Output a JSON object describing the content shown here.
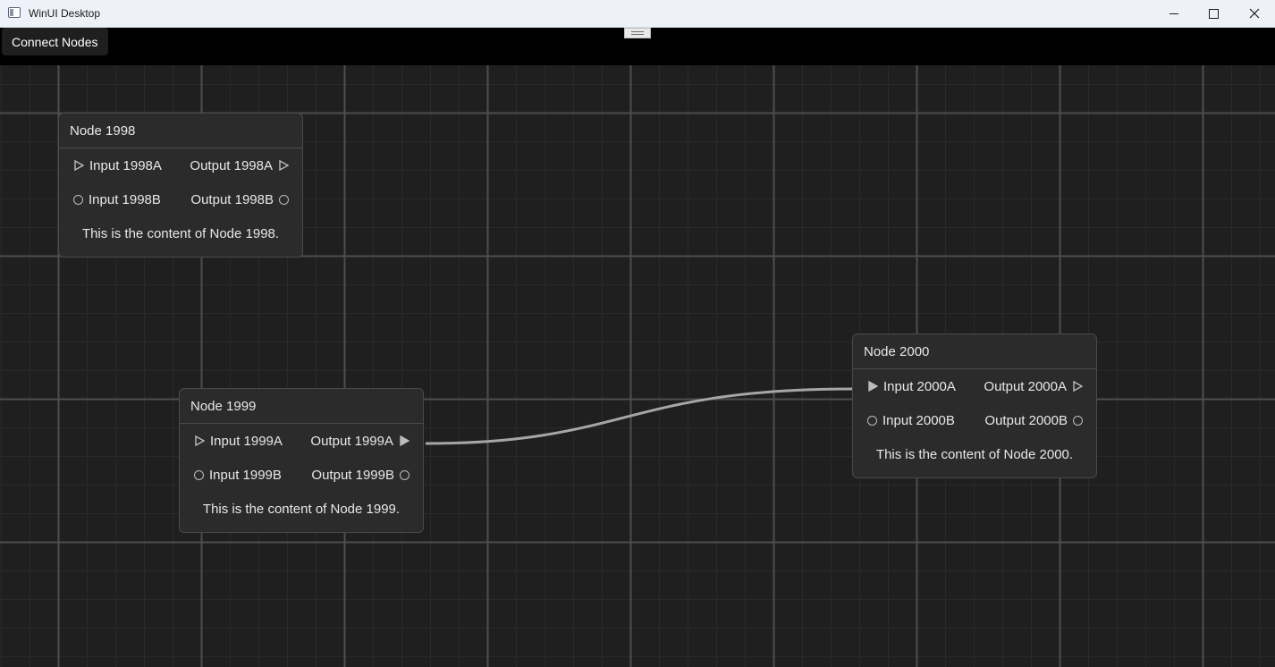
{
  "window": {
    "title": "WinUI Desktop",
    "icon": "app-window-icon",
    "controls": [
      "minimize-icon",
      "maximize-icon",
      "close-icon"
    ]
  },
  "toolbar": {
    "connect_label": "Connect Nodes"
  },
  "colors": {
    "canvas_bg": "#1f1f1f",
    "grid_minor": "#2a2a2a",
    "grid_major": "#4e4e4e",
    "node_bg": "#2b2b2b",
    "node_border": "#4a4a4a",
    "wire": "#a6a6a6"
  },
  "nodes": [
    {
      "title": "Node 1998",
      "inputs": [
        {
          "label": "Input 1998A",
          "pin": "hollow-triangle"
        },
        {
          "label": "Input 1998B",
          "pin": "hollow-circle"
        }
      ],
      "outputs": [
        {
          "label": "Output 1998A",
          "pin": "hollow-triangle"
        },
        {
          "label": "Output 1998B",
          "pin": "hollow-circle"
        }
      ],
      "content": "This is the content of Node 1998."
    },
    {
      "title": "Node 1999",
      "inputs": [
        {
          "label": "Input 1999A",
          "pin": "hollow-triangle"
        },
        {
          "label": "Input 1999B",
          "pin": "hollow-circle"
        }
      ],
      "outputs": [
        {
          "label": "Output 1999A",
          "pin": "filled-triangle"
        },
        {
          "label": "Output 1999B",
          "pin": "hollow-circle"
        }
      ],
      "content": "This is the content of Node 1999."
    },
    {
      "title": "Node 2000",
      "inputs": [
        {
          "label": "Input 2000A",
          "pin": "filled-triangle"
        },
        {
          "label": "Input 2000B",
          "pin": "hollow-circle"
        }
      ],
      "outputs": [
        {
          "label": "Output 2000A",
          "pin": "hollow-triangle"
        },
        {
          "label": "Output 2000B",
          "pin": "hollow-circle"
        }
      ],
      "content": "This is the content of Node 2000."
    }
  ],
  "connections": [
    {
      "from": "Output 1999A",
      "to": "Input 2000A"
    }
  ]
}
